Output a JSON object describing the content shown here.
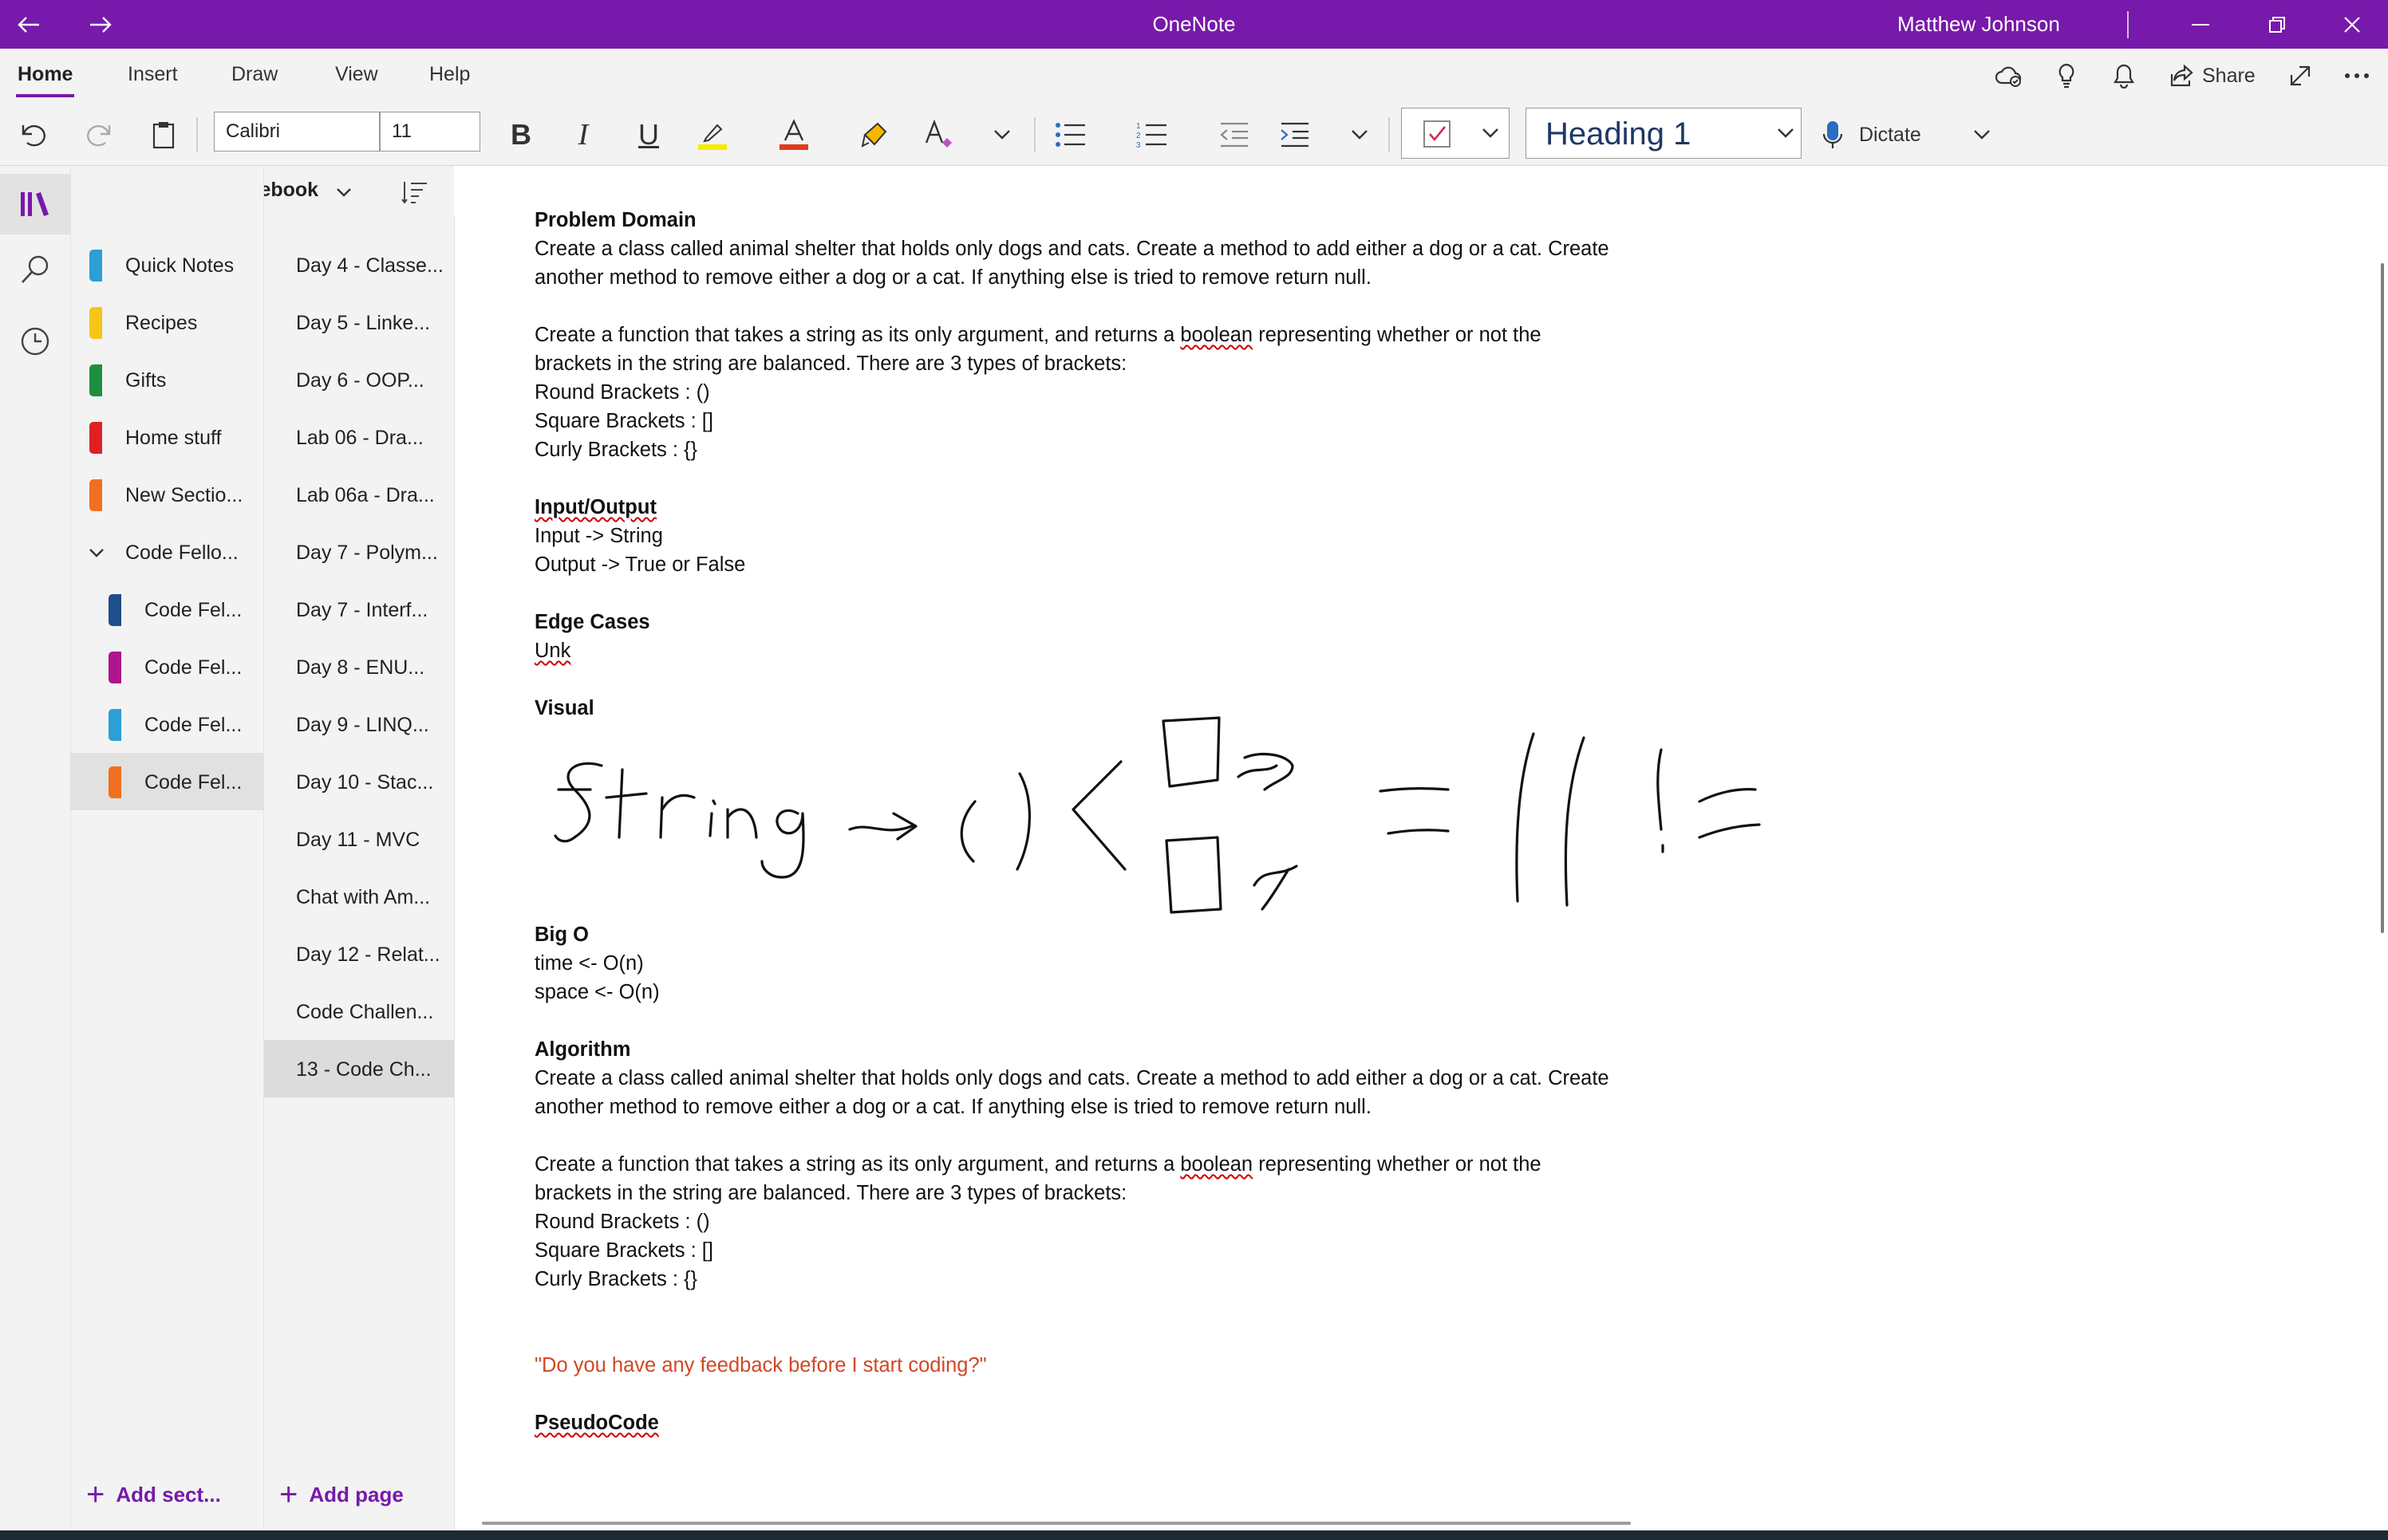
{
  "window": {
    "title": "OneNote",
    "user": "Matthew Johnson"
  },
  "ribbon_tabs": [
    "Home",
    "Insert",
    "Draw",
    "View",
    "Help"
  ],
  "share_label": "Share",
  "toolbar": {
    "font_name": "Calibri",
    "font_size": "11",
    "style": "Heading 1",
    "dictate_label": "Dictate"
  },
  "notebook": {
    "name": "Matthew's Notebook"
  },
  "sections": [
    {
      "label": "Quick Notes",
      "color": "#2b9fd6"
    },
    {
      "label": "Recipes",
      "color": "#f5c518"
    },
    {
      "label": "Gifts",
      "color": "#1e8f3e"
    },
    {
      "label": "Home stuff",
      "color": "#e02020"
    },
    {
      "label": "New Sectio...",
      "color": "#f07020"
    },
    {
      "label": "Code Fello...",
      "color": ""
    },
    {
      "label": "Code Fel...",
      "color": "#1f4e8c"
    },
    {
      "label": "Code Fel...",
      "color": "#b0148c"
    },
    {
      "label": "Code Fel...",
      "color": "#2b9fd6"
    },
    {
      "label": "Code Fel...",
      "color": "#f07020"
    }
  ],
  "pages": [
    "Day 4 - Classe...",
    "Day 5 - Linke...",
    "Day 6 - OOP...",
    "Lab 06 - Dra...",
    "Lab 06a - Dra...",
    "Day 7 - Polym...",
    "Day 7 - Interf...",
    "Day 8 - ENU...",
    "Day 9 - LINQ...",
    "Day 10 - Stac...",
    "Day 11 - MVC",
    "Chat with Am...",
    "Day 12 - Relat...",
    "Code Challen...",
    "13 - Code Ch..."
  ],
  "add_section_label": "Add sect...",
  "add_page_label": "Add page",
  "content": {
    "problem_domain_heading": "Problem Domain",
    "pd_line1": "Create a class called animal shelter that holds only dogs and cats. Create a method to add either a dog or a cat. Create",
    "pd_line2": "another method to remove either a dog or a cat. If anything else is tried to remove return null.",
    "pd_line3a": "Create a function that takes a string as its only argument, and returns a ",
    "pd_line3_word": "boolean",
    "pd_line3b": " representing whether or not the",
    "pd_line4": "brackets in the string are balanced. There are 3 types of brackets:",
    "pd_round": "Round Brackets : ()",
    "pd_square": "Square Brackets : []",
    "pd_curly": "Curly Brackets : {}",
    "io_heading": "Input/Output",
    "io_input": "Input -> String",
    "io_output": "Output -> True or False",
    "edge_heading": "Edge Cases",
    "edge_value": "Unk",
    "visual_heading": "Visual",
    "bigo_heading": "Big O",
    "bigo_time": "time <- O(n)",
    "bigo_space": "space <- O(n)",
    "algo_heading": "Algorithm",
    "algo_line1": "Create a class called animal shelter that holds only dogs and cats. Create a method to add either a dog or a cat. Create",
    "algo_line2": "another method to remove either a dog or a cat. If anything else is tried to remove return null.",
    "algo_line3a": "Create a function that takes a string as its only argument, and returns a ",
    "algo_line3_word": "boolean",
    "algo_line3b": " representing whether or not the",
    "algo_line4": "brackets in the string are balanced. There are 3 types of brackets:",
    "algo_round": "Round Brackets : ()",
    "algo_square": "Square Brackets : []",
    "algo_curly": "Curly Brackets : {}",
    "feedback_quote": "\"Do you have any feedback before I start coding?\"",
    "pseudo_heading": "PseudoCode"
  }
}
